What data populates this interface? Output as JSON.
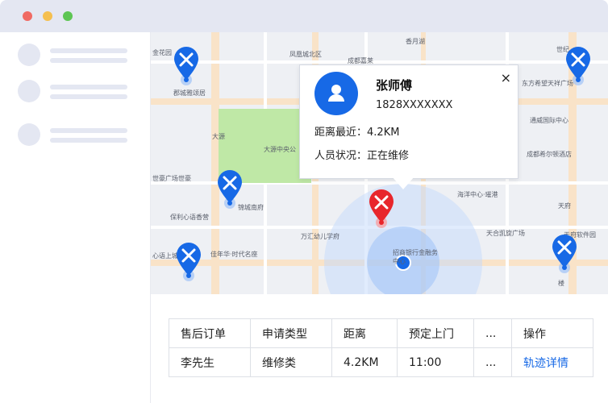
{
  "window": {
    "traffic_lights": [
      "#f06a63",
      "#f5bf4f",
      "#5dc553"
    ]
  },
  "map": {
    "labels": [
      "金花园",
      "郡城雅颂居",
      "凤凰城北区",
      "成都嘉莱",
      "香月湖",
      "世纪",
      "东方希望天祥广场",
      "通威国际中心",
      "成都希尔顿酒店",
      "大源",
      "大源中央公",
      "世豪广场世豪",
      "保利心语香营",
      "锦城南府",
      "佳年华·时代名座",
      "万汇幼儿学府",
      "海洋中心·璀港",
      "天府",
      "天合凯旋广场",
      "天府软件园",
      "招商银行金融务中心",
      "心语上城",
      "楼"
    ],
    "colors": {
      "pin_blue": "#1769e6",
      "pin_red": "#e8262c",
      "radius": "#c3d9fb"
    }
  },
  "popup": {
    "name": "张师傅",
    "phone": "1828XXXXXXX",
    "distance_label": "距离最近：",
    "distance_value": "4.2KM",
    "status_label": "人员状况：",
    "status_value": "正在维修",
    "close": "×"
  },
  "table": {
    "headers": [
      "售后订单",
      "申请类型",
      "距离",
      "预定上门",
      "...",
      "操作"
    ],
    "row": {
      "customer": "李先生",
      "type": "维修类",
      "distance": "4.2KM",
      "time": "11:00",
      "more": "...",
      "action": "轨迹详情"
    }
  }
}
